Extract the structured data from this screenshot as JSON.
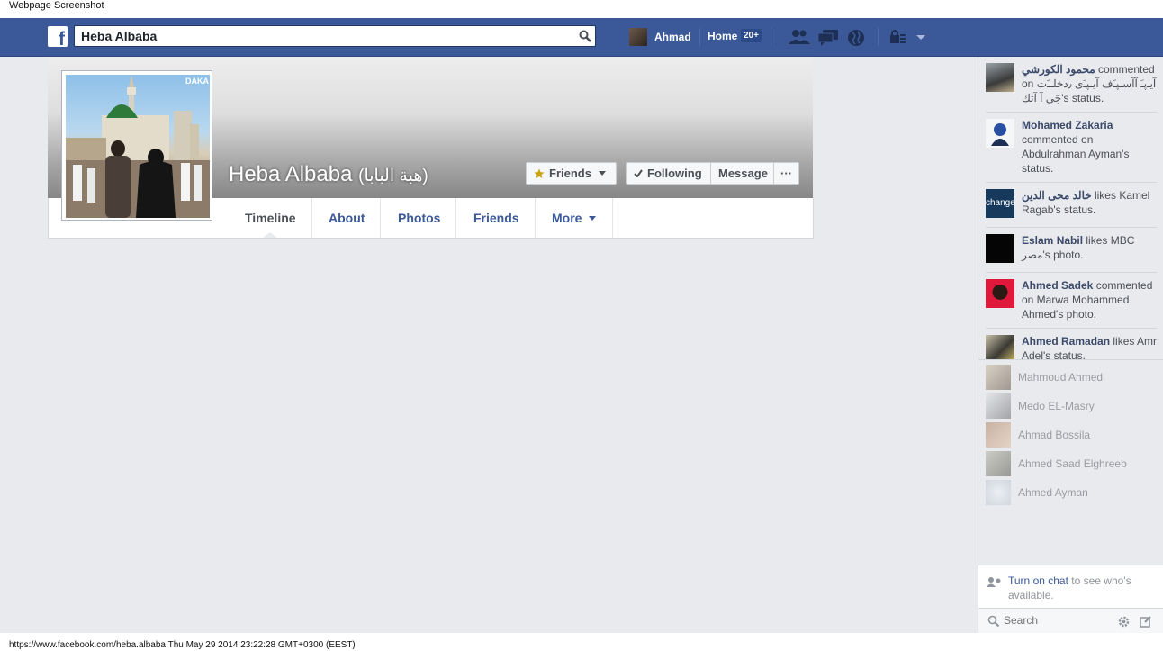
{
  "screenshot_label": "Webpage Screenshot",
  "topbar": {
    "logo": "f",
    "search_value": "Heba Albaba",
    "user_name": "Ahmad",
    "home_label": "Home",
    "home_badge": "20+",
    "icons": [
      "friend-requests-icon",
      "messages-icon",
      "notifications-globe-icon",
      "privacy-shortcuts-icon",
      "account-caret-icon"
    ],
    "brand_color": "#3b5998"
  },
  "profile": {
    "name": "Heba Albaba",
    "alt_name": "(هبة البابا)",
    "watermark": "DAKA",
    "buttons": {
      "friends": "Friends",
      "following": "Following",
      "message": "Message",
      "more": "···"
    },
    "tabs": [
      "Timeline",
      "About",
      "Photos",
      "Friends",
      "More"
    ],
    "active_tab": "Timeline"
  },
  "ticker": [
    {
      "name": "محمود الكورشي",
      "text": " commented on آيـﭘﹷ آآسـﭙﹷف آيـﭙﹷى ٫دخلـﹷت جٓي آ آتك's status."
    },
    {
      "name": "Mohamed Zakaria",
      "text": " commented on Abdulrahman Ayman's status."
    },
    {
      "name": "خالد محى الدين",
      "text": " likes Kamel Ragab's status."
    },
    {
      "name": "Eslam Nabil",
      "text": " likes MBC مصر's photo."
    },
    {
      "name": "Ahmed Sadek",
      "text": " commented on Marwa Mohammed Ahmed's photo."
    },
    {
      "name": "Ahmed Ramadan",
      "text": " likes Amr Adel's status."
    }
  ],
  "ticker_thumb_label": "change",
  "chat": {
    "contacts": [
      "Mahmoud Ahmed",
      "Medo EL-Masry",
      "Ahmad Bossila",
      "Ahmed Saad Elghreeb",
      "Ahmed Ayman"
    ],
    "turn_on_link": "Turn on chat",
    "turn_on_text": " to see who's available.",
    "search_placeholder": "Search"
  },
  "status_bar": "https://www.facebook.com/heba.albaba Thu May 29 2014 23:22:28 GMT+0300 (EEST)"
}
